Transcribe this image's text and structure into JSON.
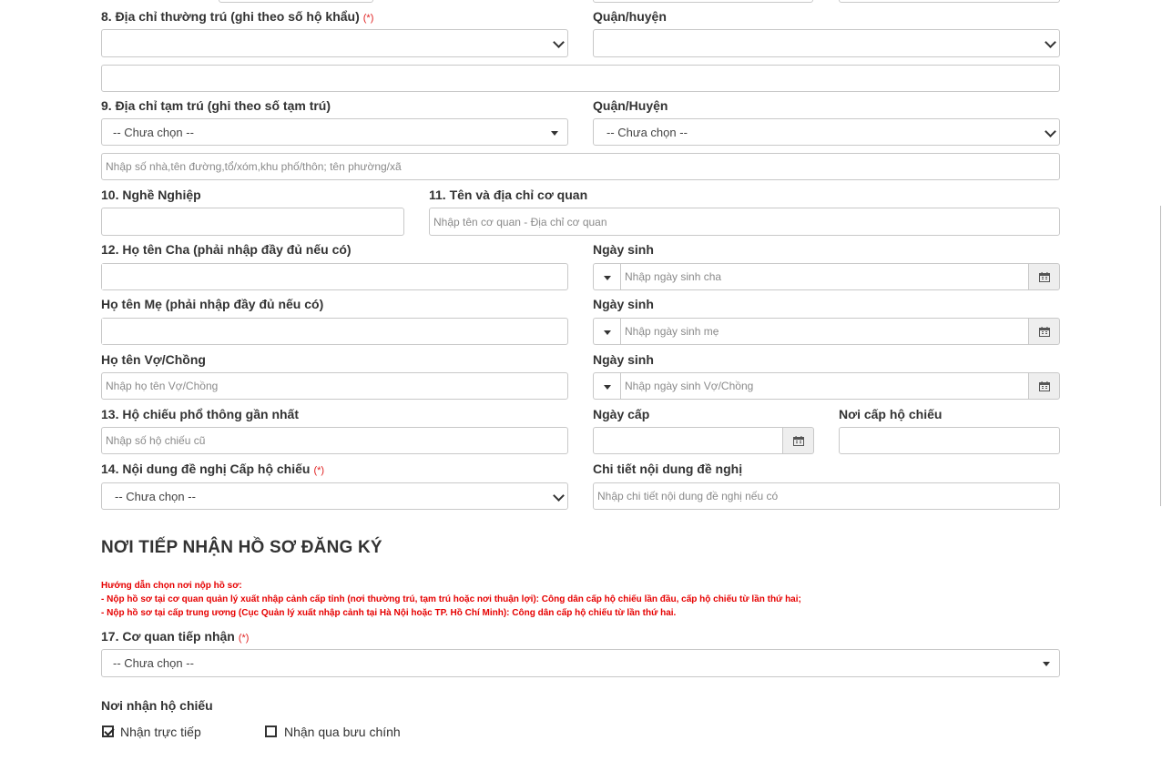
{
  "fields": {
    "f8": {
      "label": "8. Địa chỉ thường trú (ghi theo số hộ khẩu)",
      "required": "(*)"
    },
    "f8_district": {
      "label": "Quận/huyện"
    },
    "f9": {
      "label": "9. Địa chỉ tạm trú (ghi theo số tạm trú)",
      "select": "-- Chưa chọn --"
    },
    "f9_district": {
      "label": "Quận/Huyện",
      "select": "-- Chưa chọn --"
    },
    "f9_address": {
      "placeholder": "Nhập số nhà,tên đường,tổ/xóm,khu phố/thôn; tên phường/xã"
    },
    "f10": {
      "label": "10. Nghề Nghiệp"
    },
    "f11": {
      "label": "11. Tên và địa chỉ cơ quan",
      "placeholder": "Nhập tên cơ quan - Địa chỉ cơ quan"
    },
    "f12_father": {
      "label": "12. Họ tên Cha (phải nhập đầy đủ nếu có)"
    },
    "father_dob": {
      "label": "Ngày sinh",
      "placeholder": "Nhập ngày sinh cha"
    },
    "mother": {
      "label": "Họ tên Mẹ (phải nhập đầy đủ nếu có)"
    },
    "mother_dob": {
      "label": "Ngày sinh",
      "placeholder": "Nhập ngày sinh mẹ"
    },
    "spouse": {
      "label": "Họ tên Vợ/Chồng",
      "placeholder": "Nhập họ tên Vợ/Chồng"
    },
    "spouse_dob": {
      "label": "Ngày sinh",
      "placeholder": "Nhập ngày sinh Vợ/Chồng"
    },
    "f13": {
      "label": "13. Hộ chiếu phổ thông gần nhất",
      "placeholder": "Nhập số hộ chiếu cũ"
    },
    "issue_date": {
      "label": "Ngày cấp"
    },
    "issue_place": {
      "label": "Nơi cấp hộ chiếu"
    },
    "f14": {
      "label": "14. Nội dung đề nghị Cấp hộ chiếu",
      "required": "(*)",
      "select": "-- Chưa chọn --"
    },
    "f14_detail": {
      "label": "Chi tiết nội dung đề nghị",
      "placeholder": "Nhập chi tiết nội dung đề nghị nếu có"
    }
  },
  "section": {
    "title": "NƠI TIẾP NHẬN HỒ SƠ ĐĂNG KÝ",
    "guide": [
      "Hướng dẫn chọn nơi nộp hồ sơ:",
      "- Nộp hồ sơ tại cơ quan quản lý xuất nhập cảnh cấp tỉnh (nơi thường trú, tạm trú hoặc nơi thuận lợi): Công dân cấp hộ chiếu lần đầu, cấp hộ chiếu từ lần thứ hai;",
      "- Nộp hồ sơ tại cấp trung ương (Cục Quản lý xuất nhập cảnh tại Hà Nội hoặc TP. Hồ Chí Minh): Công dân cấp hộ chiếu từ lần thứ hai."
    ],
    "f17": {
      "label": "17. Cơ quan tiếp nhận",
      "required": "(*)",
      "select": "-- Chưa chọn --"
    },
    "delivery": {
      "label": "Nơi nhận hộ chiếu",
      "options": [
        {
          "label": "Nhận trực tiếp",
          "checked": true
        },
        {
          "label": "Nhận qua bưu chính",
          "checked": false
        }
      ]
    }
  },
  "icons": {
    "calendar": "calendar-icon",
    "dropdown": "chevron-down-icon",
    "caret": "caret-down-icon"
  }
}
